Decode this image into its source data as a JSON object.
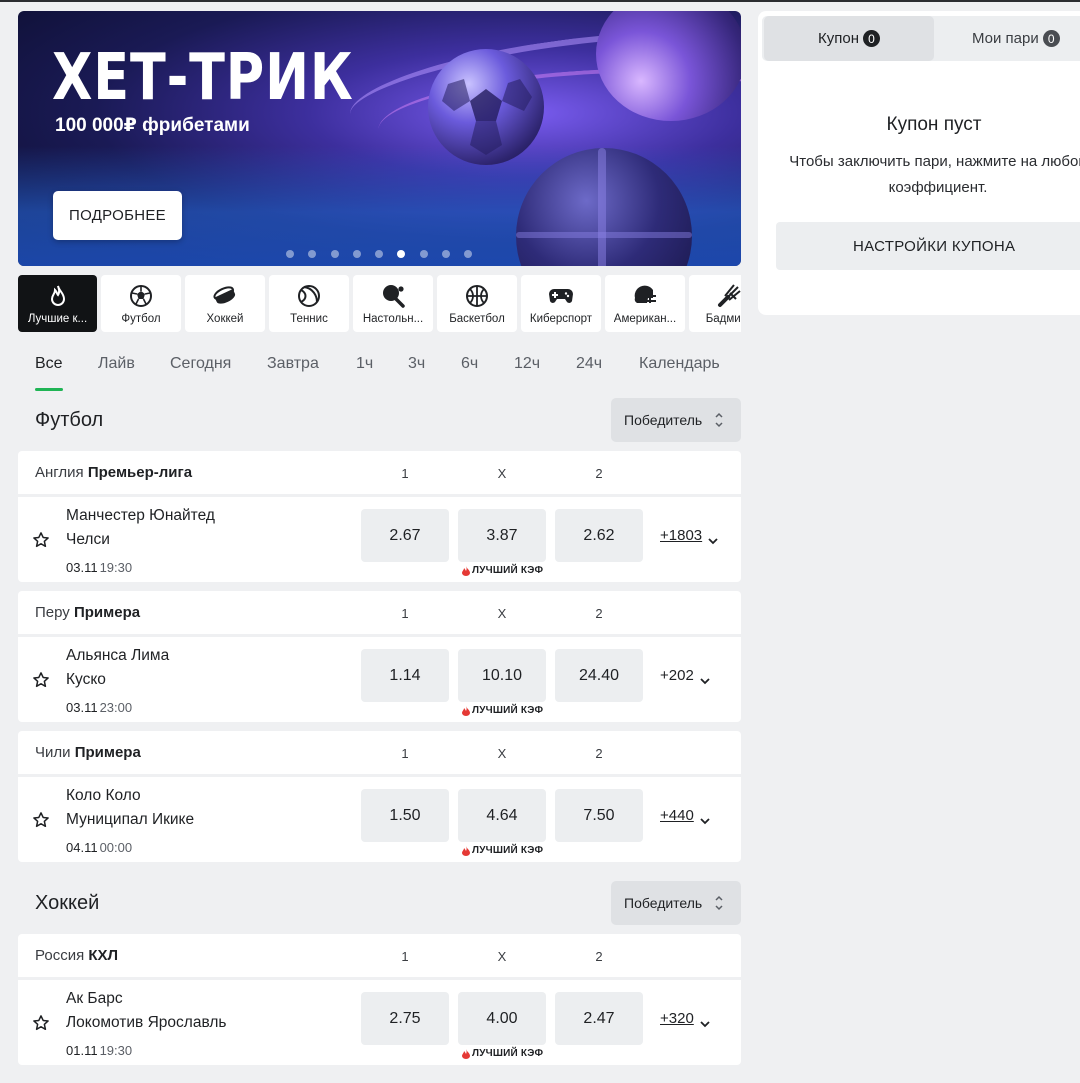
{
  "banner": {
    "title": "ХЕТ-ТРИК",
    "subtitle": "100 000₽ фрибетами",
    "button": "ПОДРОБНЕЕ",
    "dots_total": 9,
    "dots_active_index": 5
  },
  "sports": [
    {
      "label": "Лучшие к...",
      "icon": "fire-icon"
    },
    {
      "label": "Футбол",
      "icon": "soccer-ball-icon"
    },
    {
      "label": "Хоккей",
      "icon": "hockey-puck-icon"
    },
    {
      "label": "Теннис",
      "icon": "tennis-ball-icon"
    },
    {
      "label": "Настольн...",
      "icon": "table-tennis-icon"
    },
    {
      "label": "Баскетбол",
      "icon": "basketball-icon"
    },
    {
      "label": "Киберспорт",
      "icon": "gamepad-icon"
    },
    {
      "label": "Американ...",
      "icon": "football-helmet-icon"
    },
    {
      "label": "Бадминт",
      "icon": "shuttlecock-icon"
    }
  ],
  "time_tabs": [
    "Все",
    "Лайв",
    "Сегодня",
    "Завтра",
    "1ч",
    "3ч",
    "6ч",
    "12ч",
    "24ч",
    "Календарь"
  ],
  "sections": [
    {
      "title": "Футбол",
      "market": "Победитель",
      "leagues": [
        {
          "country": "Англия",
          "league": "Премьер-лига",
          "cols": [
            "1",
            "X",
            "2"
          ],
          "match": {
            "team1": "Манчестер Юнайтед",
            "team2": "Челси",
            "date": "03.11",
            "time": "19:30",
            "odds": [
              "2.67",
              "3.87",
              "2.62"
            ],
            "best": "ЛУЧШИЙ КЭФ",
            "more": "+1803"
          }
        },
        {
          "country": "Перу",
          "league": "Примера",
          "cols": [
            "1",
            "X",
            "2"
          ],
          "match": {
            "team1": "Альянса Лима",
            "team2": "Куско",
            "date": "03.11",
            "time": "23:00",
            "odds": [
              "1.14",
              "10.10",
              "24.40"
            ],
            "best": "ЛУЧШИЙ КЭФ",
            "more": "+202"
          }
        },
        {
          "country": "Чили",
          "league": "Примера",
          "cols": [
            "1",
            "X",
            "2"
          ],
          "match": {
            "team1": "Коло Коло",
            "team2": "Муниципал Икике",
            "date": "04.11",
            "time": "00:00",
            "odds": [
              "1.50",
              "4.64",
              "7.50"
            ],
            "best": "ЛУЧШИЙ КЭФ",
            "more": "+440"
          }
        }
      ]
    },
    {
      "title": "Хоккей",
      "market": "Победитель",
      "leagues": [
        {
          "country": "Россия",
          "league": "КХЛ",
          "cols": [
            "1",
            "X",
            "2"
          ],
          "match": {
            "team1": "Ак Барс",
            "team2": "Локомотив Ярославль",
            "date": "01.11",
            "time": "19:30",
            "odds": [
              "2.75",
              "4.00",
              "2.47"
            ],
            "best": "ЛУЧШИЙ КЭФ",
            "more": "+320"
          }
        }
      ]
    }
  ],
  "coupon": {
    "tab_coupon": "Купон",
    "tab_coupon_count": "0",
    "tab_bets": "Мои пари",
    "tab_bets_count": "0",
    "empty_title": "Купон пуст",
    "empty_text": "Чтобы заключить пари, нажмите на любой коэффициент.",
    "settings_button": "НАСТРОЙКИ КУПОНА"
  },
  "colors": {
    "accent": "#1fb455",
    "best_kef_fire": "#e53935",
    "active_sport_bg": "#111315"
  }
}
